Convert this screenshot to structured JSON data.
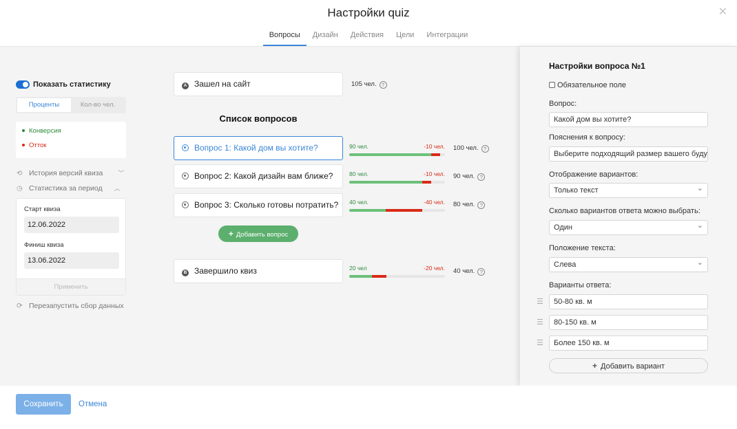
{
  "header": {
    "title": "Настройки quiz",
    "close_icon": "close-icon",
    "tabs": [
      {
        "label": "Вопросы",
        "active": true
      },
      {
        "label": "Дизайн",
        "active": false
      },
      {
        "label": "Действия",
        "active": false
      },
      {
        "label": "Цели",
        "active": false
      },
      {
        "label": "Интеграции",
        "active": false
      }
    ]
  },
  "sidebar": {
    "show_stats_label": "Показать статистику",
    "show_stats_on": true,
    "mode_tabs": [
      "Проценты",
      "Кол-во чел."
    ],
    "legend": {
      "conversion": "Конверсия",
      "outflow": "Отток"
    },
    "history_link": "История версий квиза",
    "period_link": "Статистика за период",
    "start_label": "Старт квиза",
    "start_date": "12.06.2022",
    "end_label": "Финиш квиза",
    "end_date": "13.06.2022",
    "apply_label": "Применить",
    "restart_label": "Перезапустить сбор данных"
  },
  "funnel": {
    "start": {
      "letter": "A",
      "label": "Зашел на сайт",
      "count": "105 чел."
    },
    "list_title": "Список вопросов",
    "questions": [
      {
        "label": "Вопрос 1: Какой дом вы хотите?",
        "conv": "90 чел.",
        "out": "-10 чел.",
        "count": "100 чел.",
        "conv_frac": 0.857,
        "out_frac": 0.095
      },
      {
        "label": "Вопрос 2: Какой дизайн вам ближе?",
        "conv": "80 чел.",
        "out": "-10 чел.",
        "count": "90 чел.",
        "conv_frac": 0.762,
        "out_frac": 0.095
      },
      {
        "label": "Вопрос 3: Сколько готовы потратить?",
        "conv": "40 чел.",
        "out": "-40 чел.",
        "count": "80 чел.",
        "conv_frac": 0.381,
        "out_frac": 0.381
      }
    ],
    "add_question": "Добавить вопрос",
    "end": {
      "letter": "B",
      "label": "Завершило квиз",
      "conv": "20 чел",
      "out": "-20 чел.",
      "count": "40 чел.",
      "conv_frac": 0.24,
      "out_frac": 0.15
    }
  },
  "question_settings": {
    "title": "Настройки вопроса №1",
    "required_label": "Обязательное поле",
    "question_label": "Вопрос:",
    "question_value": "Какой дом вы хотите?",
    "hint_label": "Пояснения к вопросу:",
    "hint_placeholder": "Выберите подходящий размер вашего будущего дома",
    "display_label": "Отображение вариантов:",
    "display_value": "Только текст",
    "count_label": "Сколько вариантов ответа можно выбрать:",
    "count_value": "Один",
    "position_label": "Положение текста:",
    "position_value": "Слева",
    "variants_label": "Варианты ответа:",
    "variants": [
      "50-80 кв. м",
      "80-150 кв. м",
      "Более 150 кв. м"
    ],
    "add_variant": "Добавить вариант"
  },
  "footer": {
    "save": "Сохранить",
    "cancel": "Отмена"
  },
  "colors": {
    "accent": "#3b86d8",
    "conversion": "#6cc07a",
    "outflow": "#d92a17",
    "add_button": "#5caf6d"
  }
}
